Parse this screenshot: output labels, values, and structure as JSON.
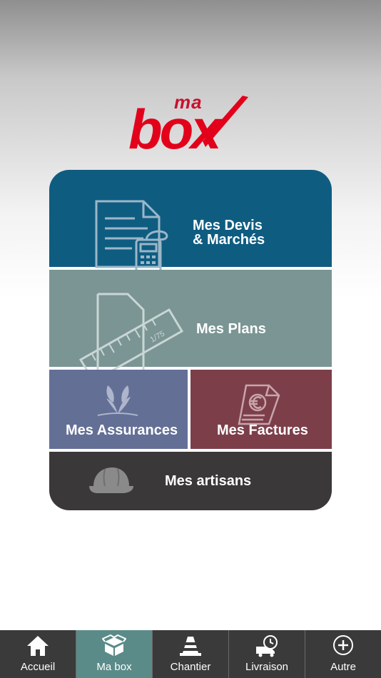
{
  "brand": {
    "small": "ma",
    "large": "box",
    "color": "#e2001a"
  },
  "tiles": {
    "devis": {
      "line1": "Mes Devis",
      "line2": "& Marchés",
      "icon": "document-calculator-icon",
      "color": "#0f5c81"
    },
    "plans": {
      "label": "Mes Plans",
      "ruler_text": "1/75",
      "icon": "plan-ruler-icon",
      "color": "#7a9594"
    },
    "assurances": {
      "label": "Mes Assurances",
      "icon": "sprout-icon",
      "color": "#636f95"
    },
    "factures": {
      "label": "Mes Factures",
      "icon": "euro-invoice-icon",
      "color": "#7c3f4a"
    },
    "artisans": {
      "label": "Mes artisans",
      "icon": "hard-hat-icon",
      "color": "#3b383a"
    }
  },
  "tabbar": {
    "items": [
      {
        "label": "Accueil",
        "icon": "home-icon"
      },
      {
        "label": "Ma box",
        "icon": "box-icon",
        "active": true
      },
      {
        "label": "Chantier",
        "icon": "traffic-cone-icon"
      },
      {
        "label": "Livraison",
        "icon": "delivery-truck-icon"
      },
      {
        "label": "Autre",
        "icon": "plus-circle-icon"
      }
    ]
  }
}
